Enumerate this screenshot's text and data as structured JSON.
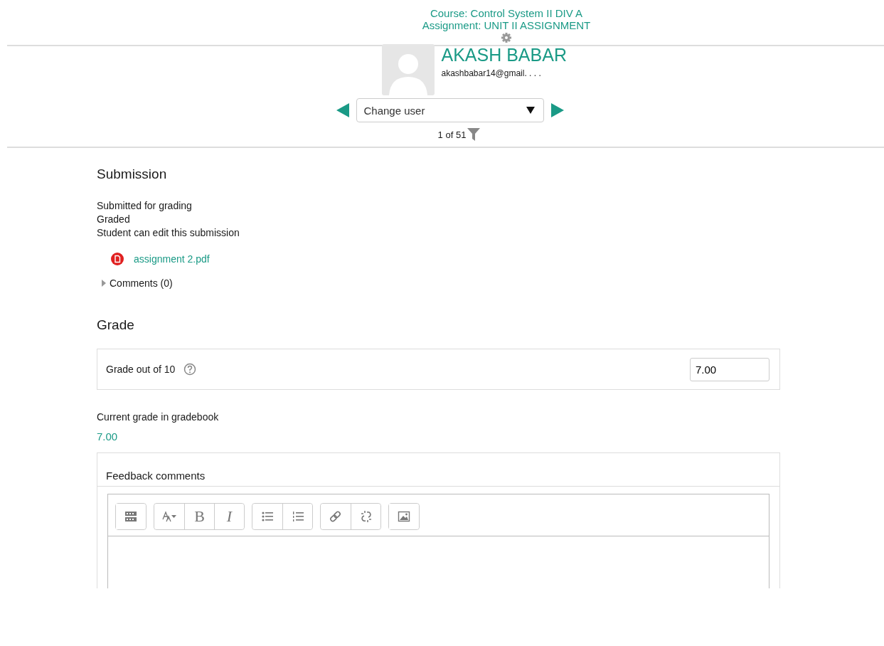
{
  "header": {
    "course": "Course: Control System II DIV A",
    "assignment": "Assignment: UNIT II ASSIGNMENT"
  },
  "user": {
    "name": "AKASH BABAR",
    "email": "akashbabar14@gmail. . . ."
  },
  "user_nav": {
    "select_value": "Change user",
    "count": "1 of 51"
  },
  "submission": {
    "heading": "Submission",
    "statuses": [
      "Submitted for grading",
      "Graded",
      "Student can edit this submission"
    ],
    "files": [
      {
        "name": "assignment 2.pdf",
        "kind": "pdf"
      }
    ],
    "comments": {
      "label": "Comments (0)",
      "expanded": false
    }
  },
  "grade": {
    "heading": "Grade",
    "label": "Grade out of 10",
    "value": "7.00",
    "current_label": "Current grade in gradebook",
    "current_value": "7.00"
  },
  "feedback": {
    "label": "Feedback comments",
    "toolbar": [
      [
        {
          "kind": "toggle"
        }
      ],
      [
        {
          "kind": "font"
        },
        {
          "kind": "bold",
          "label": "B"
        },
        {
          "kind": "italic",
          "label": "I"
        }
      ],
      [
        {
          "kind": "bullets"
        },
        {
          "kind": "numbers"
        }
      ],
      [
        {
          "kind": "link"
        },
        {
          "kind": "unlink"
        }
      ],
      [
        {
          "kind": "image"
        }
      ]
    ]
  }
}
